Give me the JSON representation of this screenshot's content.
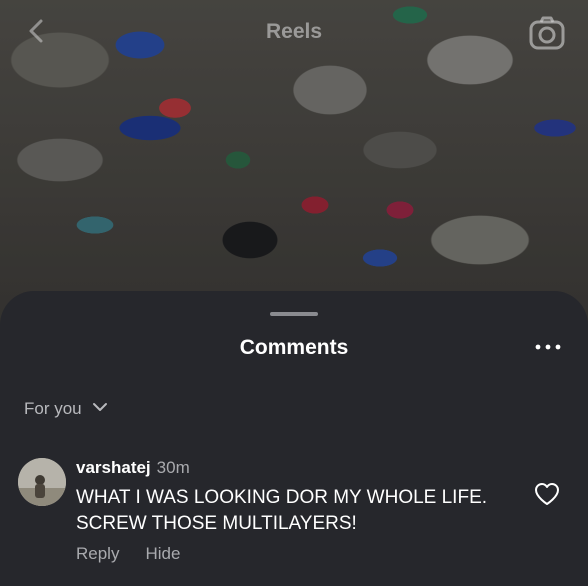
{
  "header": {
    "title": "Reels",
    "back_icon": "chevron-left-icon",
    "camera_icon": "camera-icon"
  },
  "comments_sheet": {
    "title": "Comments",
    "more_icon": "more-horizontal-icon",
    "filter": {
      "label": "For you",
      "icon": "chevron-down-icon"
    },
    "comments": [
      {
        "username": "varshatej",
        "time": "30m",
        "text": "WHAT I WAS LOOKING DOR MY WHOLE LIFE. SCREW THOSE MULTILAYERS!",
        "reply_label": "Reply",
        "hide_label": "Hide",
        "like_icon": "heart-outline-icon"
      }
    ]
  },
  "colors": {
    "sheet_background": "#26272c",
    "primary_text": "#ffffff",
    "secondary_text": "#a9aaae"
  }
}
